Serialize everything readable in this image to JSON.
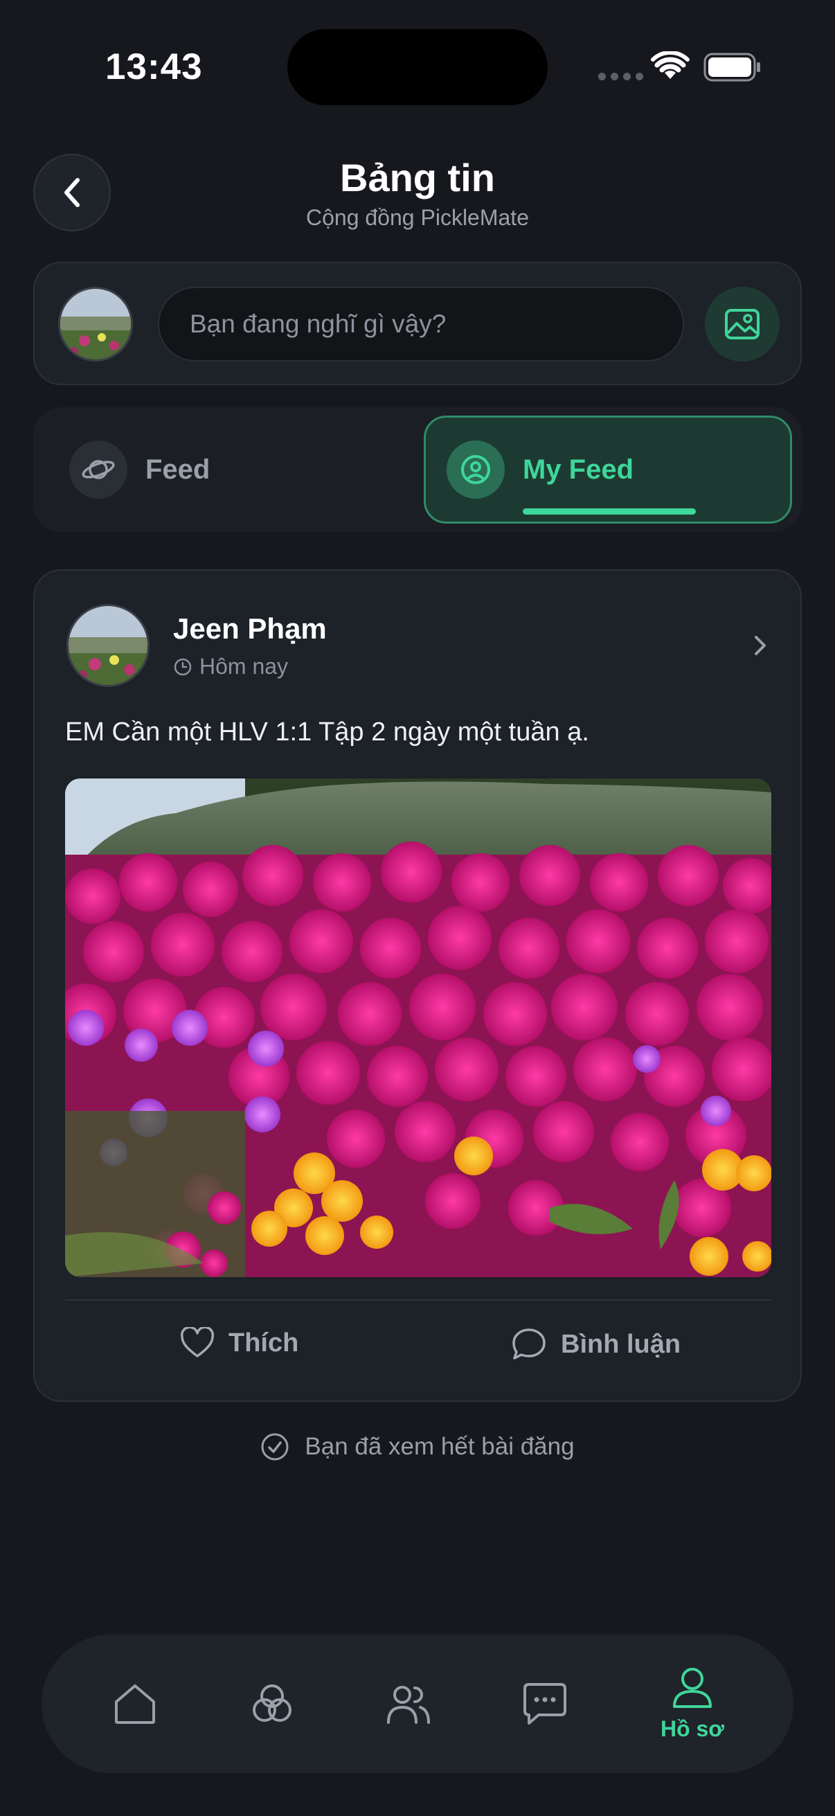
{
  "status_bar": {
    "time": "13:43"
  },
  "header": {
    "title": "Bảng tin",
    "subtitle": "Cộng đồng PickleMate"
  },
  "composer": {
    "placeholder": "Bạn đang nghĩ gì vậy?"
  },
  "tabs": [
    {
      "label": "Feed",
      "icon": "planet-icon",
      "active": false
    },
    {
      "label": "My Feed",
      "icon": "user-circle-icon",
      "active": true
    }
  ],
  "post": {
    "author": "Jeen Phạm",
    "time": "Hôm nay",
    "text": "EM Cần một HLV 1:1 Tập 2 ngày một tuần ạ.",
    "image": "pink-flower-field-photo",
    "like_label": "Thích",
    "comment_label": "Bình luận"
  },
  "end_note": "Bạn đã xem hết bài đăng",
  "bottom_nav": {
    "items": [
      {
        "icon": "home-icon",
        "active": false
      },
      {
        "icon": "clubs-icon",
        "active": false
      },
      {
        "icon": "people-icon",
        "active": false
      },
      {
        "icon": "chat-icon",
        "active": false
      },
      {
        "icon": "profile-icon",
        "active": true,
        "label": "Hồ sơ"
      }
    ]
  },
  "colors": {
    "background": "#16181d",
    "card": "#1d2128",
    "accent": "#3fd69a",
    "muted_text": "#9aa0a8"
  }
}
